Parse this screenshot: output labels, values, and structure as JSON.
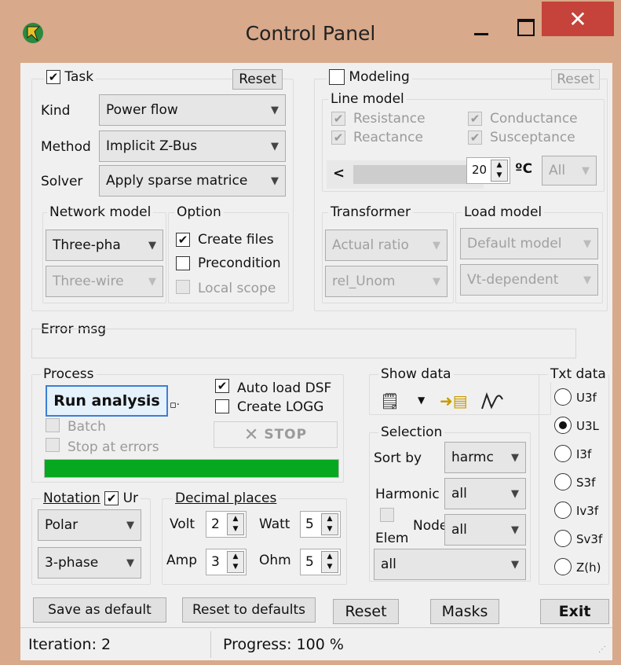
{
  "window": {
    "title": "Control Panel",
    "close_glyph": "✕"
  },
  "task": {
    "label": "Task",
    "checked": true,
    "reset": "Reset",
    "kind_label": "Kind",
    "kind_value": "Power flow",
    "method_label": "Method",
    "method_value": "Implicit Z-Bus",
    "solver_label": "Solver",
    "solver_value": "Apply sparse matrice",
    "network_model": {
      "label": "Network model",
      "value1": "Three-pha",
      "value2": "Three-wire"
    },
    "option": {
      "label": "Option",
      "create_files": "Create files",
      "precondition": "Precondition",
      "local_scope": "Local scope"
    }
  },
  "modeling": {
    "label": "Modeling",
    "reset": "Reset",
    "line_model": {
      "label": "Line model",
      "resistance": "Resistance",
      "reactance": "Reactance",
      "conductance": "Conductance",
      "susceptance": "Susceptance"
    },
    "temp_value": "20",
    "temp_unit": "ºC",
    "phase_select": "All",
    "scroll_left": "<",
    "transformer": {
      "label": "Transformer",
      "value1": "Actual ratio",
      "value2": "rel_Unom"
    },
    "load_model": {
      "label": "Load model",
      "value1": "Default model",
      "value2": "Vt-dependent"
    }
  },
  "error": {
    "label": "Error msg",
    "text": ""
  },
  "process": {
    "label": "Process",
    "run": "Run analysis",
    "auto_load": "Auto load DSF",
    "create_logg": "Create LOGG",
    "stop": "STOP",
    "batch": "Batch",
    "stop_errors": "Stop at errors",
    "progress": 1.0
  },
  "show_data": {
    "label": "Show data"
  },
  "selection": {
    "label": "Selection",
    "sort_label": "Sort by",
    "sort_value": "harmc",
    "harmonic_label": "Harmonic",
    "harmonic_value": "all",
    "node_label": "Node",
    "node_value": "all",
    "elem_label": "Elem",
    "elem_value": "all"
  },
  "txt_data": {
    "label": "Txt data",
    "options": [
      "U3f",
      "U3L",
      "I3f",
      "S3f",
      "Iv3f",
      "Sv3f",
      "Z(h)"
    ],
    "selected": 1
  },
  "notation": {
    "label": "Notation",
    "ur_label": "Ur",
    "value1": "Polar",
    "value2": "3-phase"
  },
  "decimal": {
    "label": "Decimal places",
    "volt": "Volt",
    "volt_v": "2",
    "watt": "Watt",
    "watt_v": "5",
    "amp": "Amp",
    "amp_v": "3",
    "ohm": "Ohm",
    "ohm_v": "5"
  },
  "buttons": {
    "save": "Save as default",
    "reset_defaults": "Reset to defaults",
    "reset": "Reset",
    "masks": "Masks",
    "exit": "Exit"
  },
  "status": {
    "iteration": "Iteration: 2",
    "progress": "Progress: 100 %"
  },
  "colors": {
    "frame": "#d8a98a",
    "close": "#c5433a",
    "progress": "#06a820",
    "selection_box": "#3c7fd6"
  }
}
